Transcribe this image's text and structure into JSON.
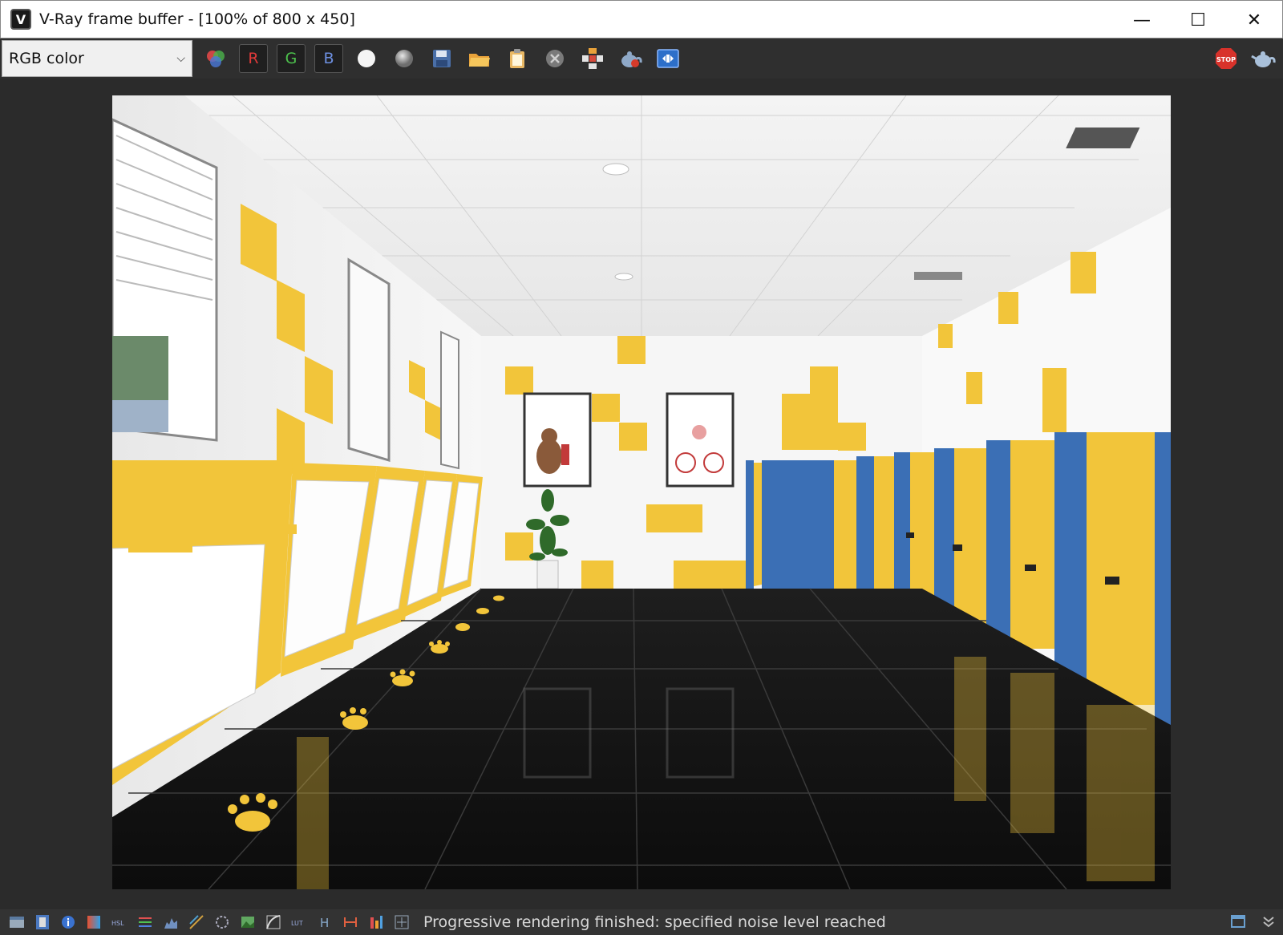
{
  "window": {
    "title": "V-Ray frame buffer - [100% of 800 x 450]",
    "minimize_glyph": "—",
    "maximize_glyph": "☐",
    "close_glyph": "✕"
  },
  "toolbar": {
    "channel_select_value": "RGB color",
    "channel_buttons": {
      "r": "R",
      "g": "G",
      "b": "B"
    },
    "icons": [
      "color-channels-icon",
      "r-channel",
      "g-channel",
      "b-channel",
      "white-sphere-icon",
      "gray-sphere-icon",
      "save-icon",
      "open-folder-icon",
      "clipboard-icon",
      "clear-icon",
      "region-render-icon",
      "teapot-render-icon",
      "history-icon",
      "stop-icon",
      "teapot-icon"
    ],
    "stop_label": "STOP"
  },
  "statusbar": {
    "message": "Progressive rendering finished: specified noise level reached",
    "icons": [
      "frame-icon",
      "film-icon",
      "info-icon",
      "gradient-icon",
      "hsl-icon",
      "levels-icon",
      "histogram-icon",
      "curves-icon",
      "lens-icon",
      "image-icon",
      "curve-icon",
      "lut-icon",
      "h-icon",
      "stretch-icon",
      "bars-icon",
      "crosshair-icon"
    ],
    "hsl_label": "HSL",
    "lut_label": "LUT",
    "h_label": "H"
  },
  "colors": {
    "accent_yellow": "#f2c53a",
    "stall_blue": "#3b6fb5",
    "floor_black": "#141414",
    "stop_red": "#d8322b"
  }
}
